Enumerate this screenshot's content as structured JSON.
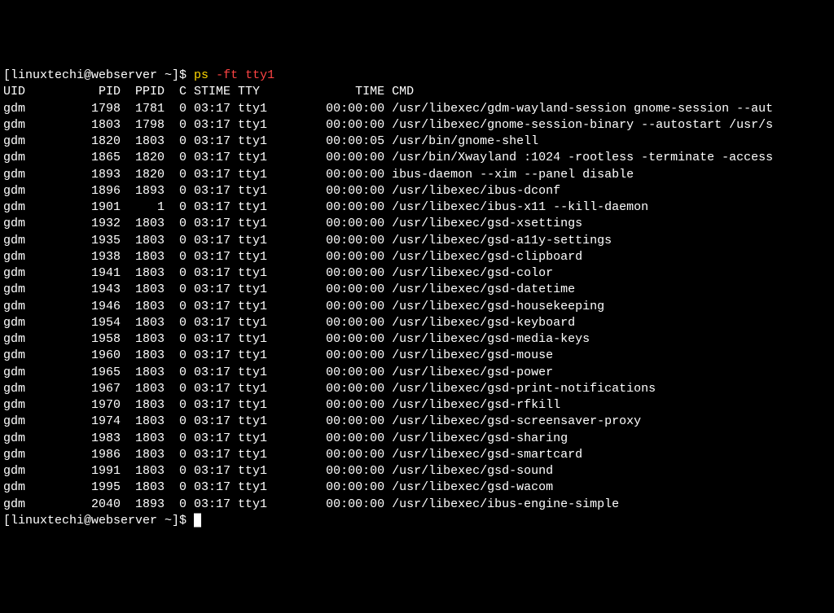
{
  "prompt": {
    "user_host": "[linuxtechi@webserver ~]$ ",
    "command_main": "ps",
    "command_args": " -ft tty1"
  },
  "header": {
    "uid": "UID",
    "pid": "PID",
    "ppid": "PPID",
    "c": "C",
    "stime": "STIME",
    "tty": "TTY",
    "time": "TIME",
    "cmd": "CMD"
  },
  "rows": [
    {
      "uid": "gdm",
      "pid": "1798",
      "ppid": "1781",
      "c": "0",
      "stime": "03:17",
      "tty": "tty1",
      "time": "00:00:00",
      "cmd": "/usr/libexec/gdm-wayland-session gnome-session --aut"
    },
    {
      "uid": "gdm",
      "pid": "1803",
      "ppid": "1798",
      "c": "0",
      "stime": "03:17",
      "tty": "tty1",
      "time": "00:00:00",
      "cmd": "/usr/libexec/gnome-session-binary --autostart /usr/s"
    },
    {
      "uid": "gdm",
      "pid": "1820",
      "ppid": "1803",
      "c": "0",
      "stime": "03:17",
      "tty": "tty1",
      "time": "00:00:05",
      "cmd": "/usr/bin/gnome-shell"
    },
    {
      "uid": "gdm",
      "pid": "1865",
      "ppid": "1820",
      "c": "0",
      "stime": "03:17",
      "tty": "tty1",
      "time": "00:00:00",
      "cmd": "/usr/bin/Xwayland :1024 -rootless -terminate -access"
    },
    {
      "uid": "gdm",
      "pid": "1893",
      "ppid": "1820",
      "c": "0",
      "stime": "03:17",
      "tty": "tty1",
      "time": "00:00:00",
      "cmd": "ibus-daemon --xim --panel disable"
    },
    {
      "uid": "gdm",
      "pid": "1896",
      "ppid": "1893",
      "c": "0",
      "stime": "03:17",
      "tty": "tty1",
      "time": "00:00:00",
      "cmd": "/usr/libexec/ibus-dconf"
    },
    {
      "uid": "gdm",
      "pid": "1901",
      "ppid": "1",
      "c": "0",
      "stime": "03:17",
      "tty": "tty1",
      "time": "00:00:00",
      "cmd": "/usr/libexec/ibus-x11 --kill-daemon"
    },
    {
      "uid": "gdm",
      "pid": "1932",
      "ppid": "1803",
      "c": "0",
      "stime": "03:17",
      "tty": "tty1",
      "time": "00:00:00",
      "cmd": "/usr/libexec/gsd-xsettings"
    },
    {
      "uid": "gdm",
      "pid": "1935",
      "ppid": "1803",
      "c": "0",
      "stime": "03:17",
      "tty": "tty1",
      "time": "00:00:00",
      "cmd": "/usr/libexec/gsd-a11y-settings"
    },
    {
      "uid": "gdm",
      "pid": "1938",
      "ppid": "1803",
      "c": "0",
      "stime": "03:17",
      "tty": "tty1",
      "time": "00:00:00",
      "cmd": "/usr/libexec/gsd-clipboard"
    },
    {
      "uid": "gdm",
      "pid": "1941",
      "ppid": "1803",
      "c": "0",
      "stime": "03:17",
      "tty": "tty1",
      "time": "00:00:00",
      "cmd": "/usr/libexec/gsd-color"
    },
    {
      "uid": "gdm",
      "pid": "1943",
      "ppid": "1803",
      "c": "0",
      "stime": "03:17",
      "tty": "tty1",
      "time": "00:00:00",
      "cmd": "/usr/libexec/gsd-datetime"
    },
    {
      "uid": "gdm",
      "pid": "1946",
      "ppid": "1803",
      "c": "0",
      "stime": "03:17",
      "tty": "tty1",
      "time": "00:00:00",
      "cmd": "/usr/libexec/gsd-housekeeping"
    },
    {
      "uid": "gdm",
      "pid": "1954",
      "ppid": "1803",
      "c": "0",
      "stime": "03:17",
      "tty": "tty1",
      "time": "00:00:00",
      "cmd": "/usr/libexec/gsd-keyboard"
    },
    {
      "uid": "gdm",
      "pid": "1958",
      "ppid": "1803",
      "c": "0",
      "stime": "03:17",
      "tty": "tty1",
      "time": "00:00:00",
      "cmd": "/usr/libexec/gsd-media-keys"
    },
    {
      "uid": "gdm",
      "pid": "1960",
      "ppid": "1803",
      "c": "0",
      "stime": "03:17",
      "tty": "tty1",
      "time": "00:00:00",
      "cmd": "/usr/libexec/gsd-mouse"
    },
    {
      "uid": "gdm",
      "pid": "1965",
      "ppid": "1803",
      "c": "0",
      "stime": "03:17",
      "tty": "tty1",
      "time": "00:00:00",
      "cmd": "/usr/libexec/gsd-power"
    },
    {
      "uid": "gdm",
      "pid": "1967",
      "ppid": "1803",
      "c": "0",
      "stime": "03:17",
      "tty": "tty1",
      "time": "00:00:00",
      "cmd": "/usr/libexec/gsd-print-notifications"
    },
    {
      "uid": "gdm",
      "pid": "1970",
      "ppid": "1803",
      "c": "0",
      "stime": "03:17",
      "tty": "tty1",
      "time": "00:00:00",
      "cmd": "/usr/libexec/gsd-rfkill"
    },
    {
      "uid": "gdm",
      "pid": "1974",
      "ppid": "1803",
      "c": "0",
      "stime": "03:17",
      "tty": "tty1",
      "time": "00:00:00",
      "cmd": "/usr/libexec/gsd-screensaver-proxy"
    },
    {
      "uid": "gdm",
      "pid": "1983",
      "ppid": "1803",
      "c": "0",
      "stime": "03:17",
      "tty": "tty1",
      "time": "00:00:00",
      "cmd": "/usr/libexec/gsd-sharing"
    },
    {
      "uid": "gdm",
      "pid": "1986",
      "ppid": "1803",
      "c": "0",
      "stime": "03:17",
      "tty": "tty1",
      "time": "00:00:00",
      "cmd": "/usr/libexec/gsd-smartcard"
    },
    {
      "uid": "gdm",
      "pid": "1991",
      "ppid": "1803",
      "c": "0",
      "stime": "03:17",
      "tty": "tty1",
      "time": "00:00:00",
      "cmd": "/usr/libexec/gsd-sound"
    },
    {
      "uid": "gdm",
      "pid": "1995",
      "ppid": "1803",
      "c": "0",
      "stime": "03:17",
      "tty": "tty1",
      "time": "00:00:00",
      "cmd": "/usr/libexec/gsd-wacom"
    },
    {
      "uid": "gdm",
      "pid": "2040",
      "ppid": "1893",
      "c": "0",
      "stime": "03:17",
      "tty": "tty1",
      "time": "00:00:00",
      "cmd": "/usr/libexec/ibus-engine-simple"
    }
  ],
  "prompt2": {
    "user_host": "[linuxtechi@webserver ~]$ "
  },
  "cursor": "█"
}
